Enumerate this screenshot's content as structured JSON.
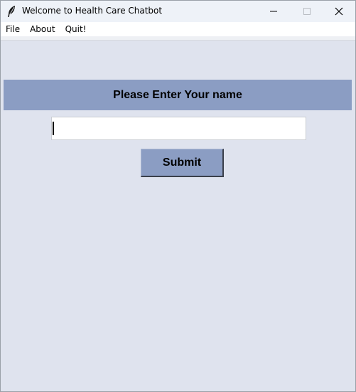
{
  "window": {
    "title": "Welcome to Health Care Chatbot",
    "icon": "feather-icon"
  },
  "menubar": {
    "items": [
      "File",
      "About",
      "Quit!"
    ]
  },
  "form": {
    "prompt": "Please Enter Your name",
    "name_value": "",
    "submit_label": "Submit"
  },
  "colors": {
    "background": "#dfe3ee",
    "accent": "#8b9dc3"
  }
}
